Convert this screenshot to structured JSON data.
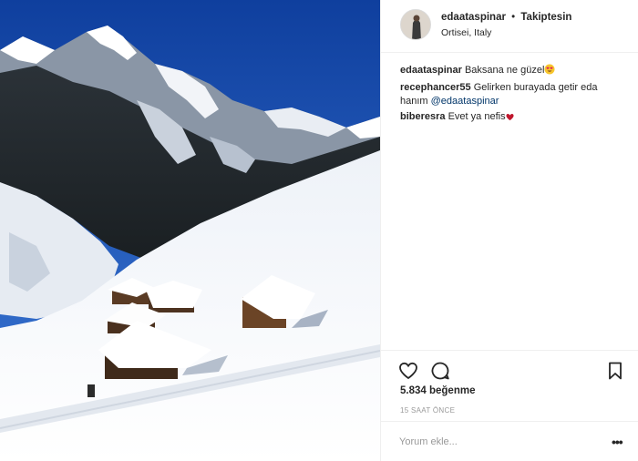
{
  "post": {
    "image_alt": "",
    "username": "edaataspinar",
    "separator": "•",
    "follow_label": "Takiptesin",
    "location": "Ortisei, Italy"
  },
  "comments": [
    {
      "user": "edaataspinar",
      "text": "Baksana ne güzel",
      "emoji": "heart-eyes-emoji"
    },
    {
      "user": "recephancer55",
      "text": "Gelirken burayada getir eda hanım",
      "mention": "@edaataspinar"
    },
    {
      "user": "biberesra",
      "text": "Evet ya nefis",
      "emoji": "heart-emoji"
    }
  ],
  "actions": {
    "like_icon": "heart-icon",
    "comment_icon": "comment-bubble-icon",
    "save_icon": "bookmark-icon",
    "likes": "5.834 beğenme",
    "time": "15 SAAT ÖNCE"
  },
  "add_comment": {
    "placeholder": "Yorum ekle...",
    "more_label": "•••"
  },
  "colors": {
    "sky": "#1f57b8",
    "snow": "#f4f6fa",
    "link": "#003569",
    "muted": "#999999"
  }
}
